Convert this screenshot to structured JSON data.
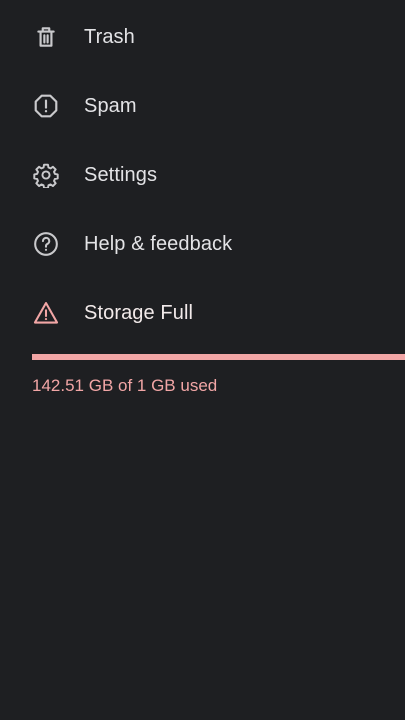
{
  "colors": {
    "background": "#1e1f22",
    "text": "#e3e3e6",
    "icon": "#c9c9cc",
    "warning": "#f2a6a6"
  },
  "menu": {
    "items": [
      {
        "label": "Trash",
        "icon": "trash-icon"
      },
      {
        "label": "Spam",
        "icon": "spam-icon"
      },
      {
        "label": "Settings",
        "icon": "gear-icon"
      },
      {
        "label": "Help & feedback",
        "icon": "help-icon"
      },
      {
        "label": "Storage Full",
        "icon": "warning-icon"
      }
    ]
  },
  "storage": {
    "usage_text": "142.51 GB of 1 GB used",
    "used_fraction": 1.0
  }
}
